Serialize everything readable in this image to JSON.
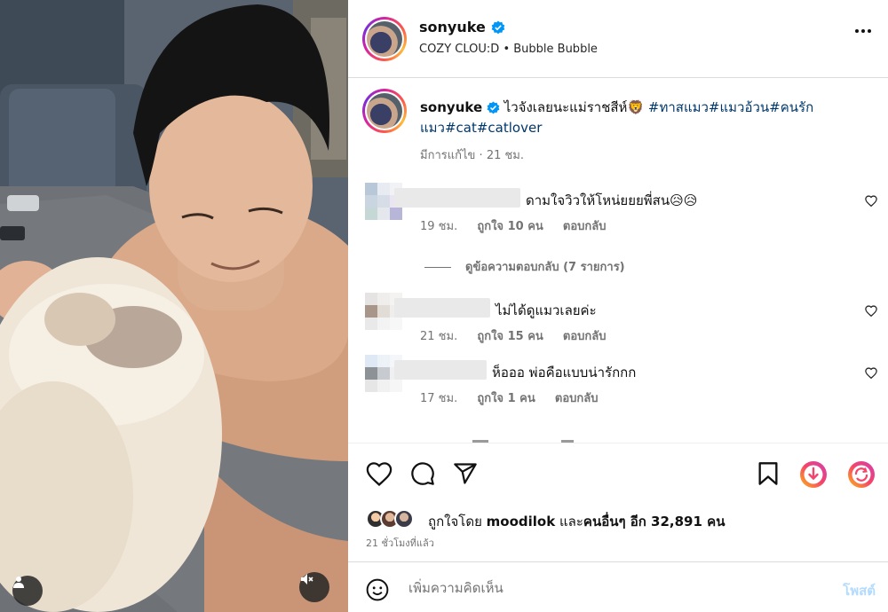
{
  "post": {
    "username": "sonyuke",
    "verified": true,
    "subtitle_artist": "COZY CLOU:D",
    "subtitle_separator": "•",
    "subtitle_song": "Bubble Bubble"
  },
  "caption": {
    "username": "sonyuke",
    "text": "ไวจังเลยนะแม่ราชสีห์🦁",
    "hashtags": "#ทาสแมว#แมวอ้วน#คนรักแมว#cat#catlover",
    "edited": "มีการแก้ไข",
    "time": "21 ชม."
  },
  "comments": [
    {
      "text": "ดามใจวิวให้โหน่ยยยพี่สน😥😥",
      "time": "19 ชม.",
      "likes": "ถูกใจ 10 คน",
      "reply": "ตอบกลับ"
    },
    {
      "text": "ไม่ได้ดูแมวเลยค่ะ",
      "time": "21 ชม.",
      "likes": "ถูกใจ 15 คน",
      "reply": "ตอบกลับ"
    },
    {
      "text": "ห็อออ พ่อคือแบบน่ารักกก",
      "time": "17 ชม.",
      "likes": "ถูกใจ 1 คน",
      "reply": "ตอบกลับ"
    }
  ],
  "view_replies": "ดูข้อความตอบกลับ (7 รายการ)",
  "likes": {
    "prefix": "ถูกใจโดย",
    "user": "moodilok",
    "middle": "และ",
    "others": "คนอื่นๆ อีก 32,891 คน"
  },
  "time_ago": "21 ชั่วโมงที่แล้ว",
  "add_comment": {
    "placeholder": "เพิ่มความคิดเห็น",
    "post_label": "โพสต์"
  },
  "colors": {
    "link": "#00376b",
    "verified": "#0095f6",
    "muted": "#737373",
    "post_disabled": "#b3dbff"
  },
  "icons": [
    "user-tag-icon",
    "mute-icon",
    "more-icon",
    "heart-icon",
    "comment-icon",
    "share-icon",
    "bookmark-icon",
    "download-icon",
    "reshare-icon",
    "emoji-icon"
  ]
}
